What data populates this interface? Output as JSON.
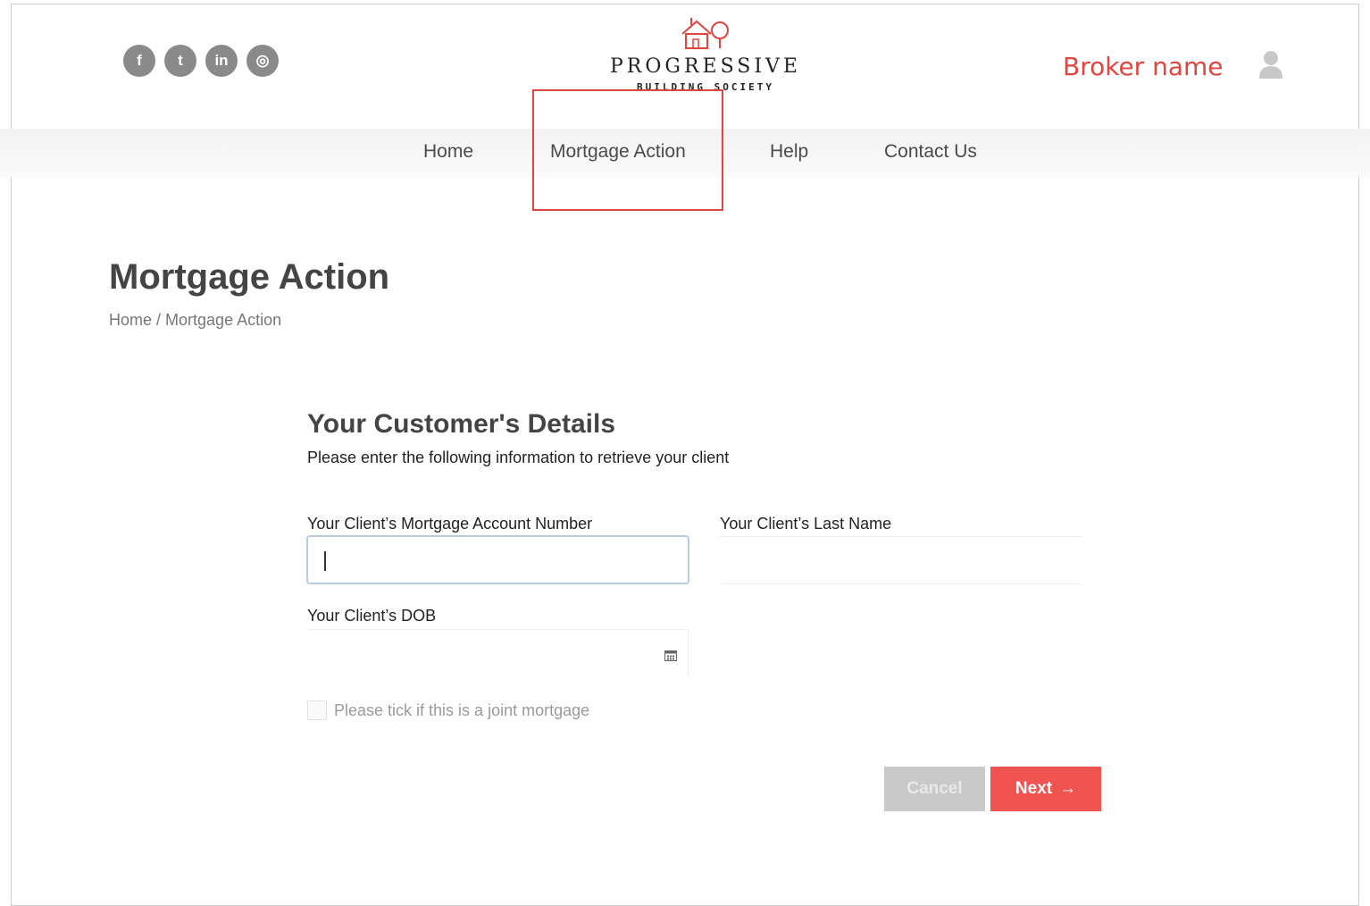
{
  "header": {
    "social": [
      {
        "icon": "facebook-icon",
        "glyph": "f"
      },
      {
        "icon": "twitter-icon",
        "glyph": "t"
      },
      {
        "icon": "linkedin-icon",
        "glyph": "in"
      },
      {
        "icon": "instagram-icon",
        "glyph": "◎"
      }
    ],
    "logo": {
      "name": "PROGRESSIVE",
      "sub": "BUILDING SOCIETY"
    },
    "broker_name": "Broker name"
  },
  "nav": {
    "items": [
      "Home",
      "Mortgage Action",
      "Help",
      "Contact Us"
    ]
  },
  "page": {
    "title": "Mortgage Action",
    "breadcrumb": {
      "home": "Home",
      "sep": " / ",
      "current": "Mortgage Action"
    }
  },
  "form": {
    "title": "Your Customer's Details",
    "subtitle": "Please enter the following information to retrieve your client",
    "account_label": "Your Client’s Mortgage Account Number",
    "account_value": "",
    "lastname_label": "Your Client’s Last Name",
    "lastname_value": "",
    "dob_label": "Your Client’s DOB",
    "dob_value": "",
    "joint_label": "Please tick if this is a joint mortgage",
    "cancel_label": "Cancel",
    "next_label": "Next"
  },
  "colors": {
    "accent": "#f05451",
    "broker": "#e0463f",
    "highlight": "#e0463f"
  }
}
